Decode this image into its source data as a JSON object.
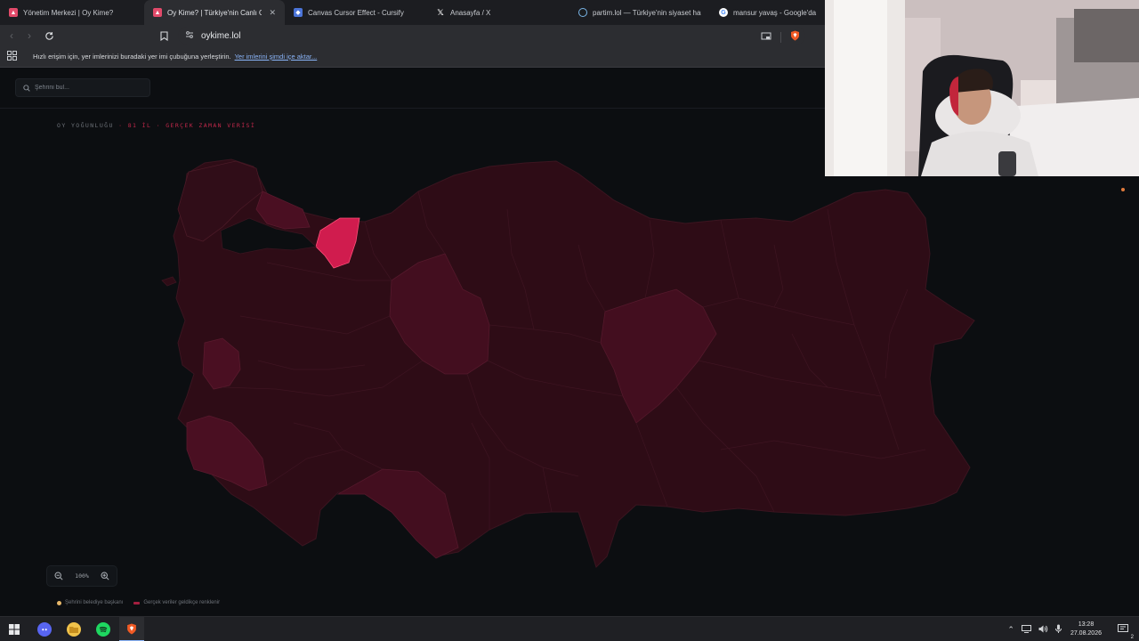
{
  "browser": {
    "tabs": [
      {
        "label": "Yönetim Merkezi | Oy Kime?",
        "icon": "oykime-favicon"
      },
      {
        "label": "Oy Kime? | Türkiye'nin Canlı Oy",
        "icon": "oykime-favicon",
        "active": true
      },
      {
        "label": "Canvas Cursor Effect - Cursify",
        "icon": "cursify-favicon"
      },
      {
        "label": "Anasayfa / X",
        "icon": "x-favicon"
      },
      {
        "label": "partim.lol — Türkiye'nin siyaset har",
        "icon": "partim-favicon"
      },
      {
        "label": "mansur yavaş - Google'da Ar",
        "icon": "google-favicon"
      }
    ],
    "url": "oykime.lol",
    "bookmark_bar": {
      "text": "Hızlı erişim için, yer imlerinizi buradaki yer imi çubuğuna yerleştirin.",
      "link": "Yer imlerini şimdi içe aktar..."
    }
  },
  "page": {
    "search": {
      "placeholder": "Şehrini bul..."
    },
    "map_caption": {
      "prefix": "OY YOĞUNLUĞU",
      "accent": "· 81 İL · GERÇEK ZAMAN VERİSİ"
    },
    "zoom": {
      "level": "100%"
    },
    "legend": [
      {
        "label": "Şehrini belediye başkanı"
      },
      {
        "label": "Gerçek veriler geldikçe renklenir"
      }
    ],
    "colors": {
      "background": "#0c0e11",
      "province_base": "#2e0c16",
      "province_mid": "#4a0f22",
      "province_high": "#d01c4e",
      "accent": "#c0284a"
    }
  },
  "taskbar": {
    "clock_time": "13:28",
    "clock_date": "27.08.2026",
    "notification_count": "2",
    "pinned": [
      "windows-start",
      "discord",
      "file-explorer",
      "spotify",
      "brave"
    ]
  }
}
